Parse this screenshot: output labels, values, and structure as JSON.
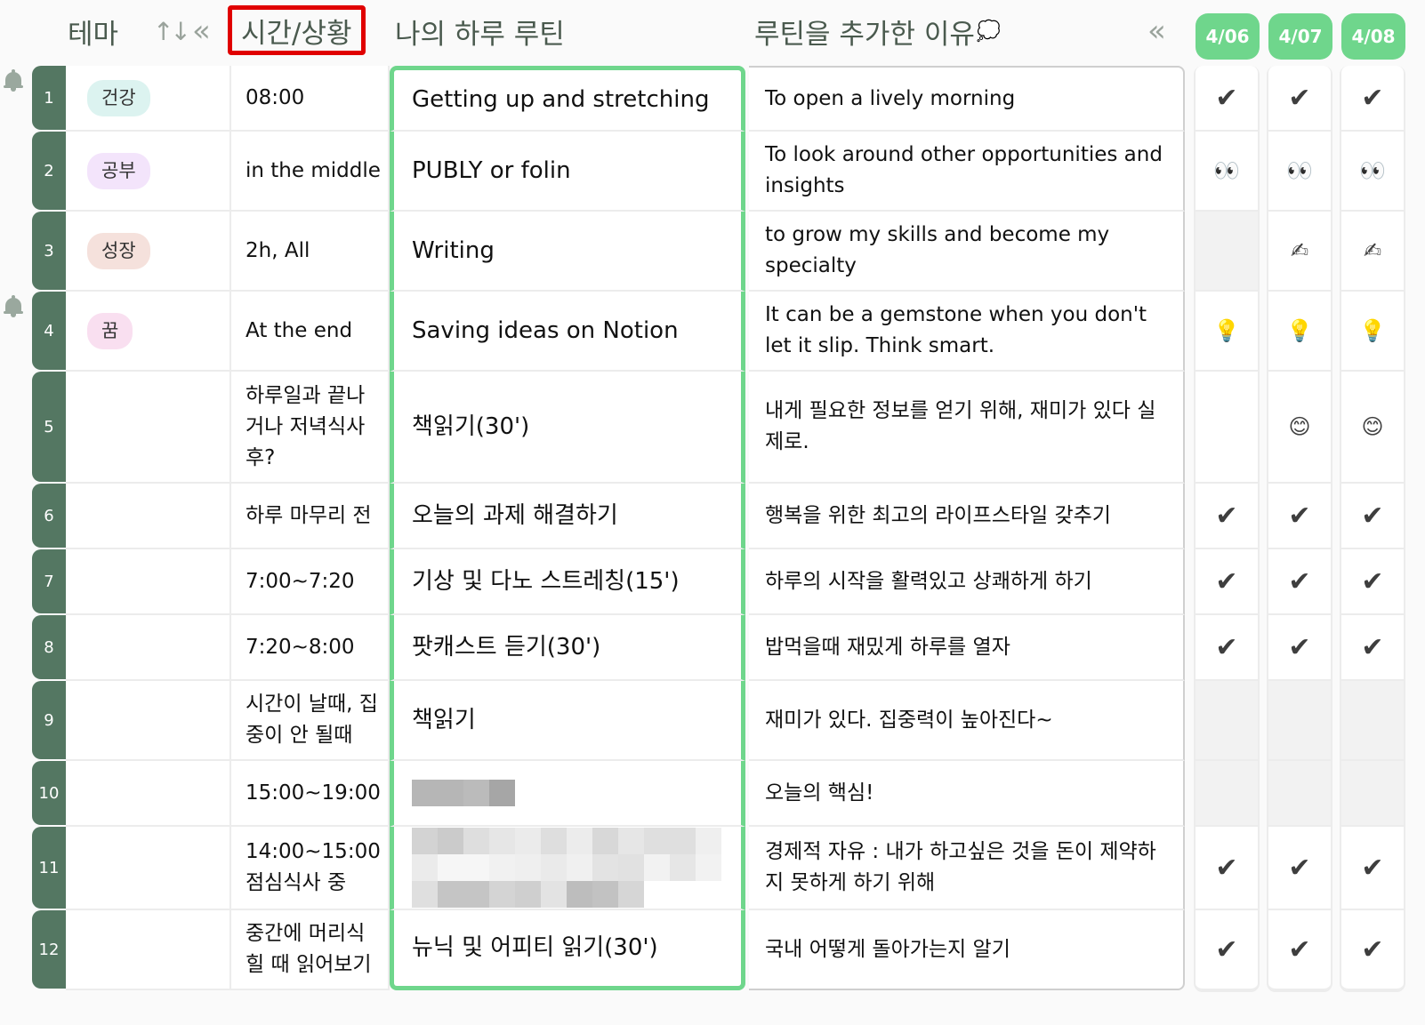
{
  "header": {
    "theme": "테마",
    "sort_icon": "↑↓",
    "collapse_icon": "«",
    "time_situation": "시간/상황",
    "my_routine": "나의 하루 루틴",
    "reason": "루틴을 추가한 이유",
    "reason_emoji": "💭",
    "collapse_dates_icon": "«",
    "dates": [
      "4/06",
      "4/07",
      "4/08"
    ]
  },
  "colors": {
    "row_number_bg": "#547762",
    "accent_green": "#6fd68c",
    "highlight_red": "#e00000"
  },
  "rows": [
    {
      "num": "1",
      "theme": "건강",
      "theme_color": "#dcf3f0",
      "time": "08:00",
      "routine": "Getting up and stretching",
      "reason": "To open a lively morning",
      "checks": [
        "✔",
        "✔",
        "✔"
      ],
      "bell": true
    },
    {
      "num": "2",
      "theme": "공부",
      "theme_color": "#f3e4fb",
      "time": "in the middle",
      "routine": "PUBLY or folin",
      "reason": "To look around other opportunities and insights",
      "checks": [
        "👀",
        "👀",
        "👀"
      ],
      "bell": false
    },
    {
      "num": "3",
      "theme": "성장",
      "theme_color": "#f5e1dc",
      "time": "2h, All",
      "routine": "Writing",
      "reason": "to grow my skills and become my specialty",
      "checks": [
        "",
        "✍",
        "✍"
      ],
      "bell": false
    },
    {
      "num": "4",
      "theme": "꿈",
      "theme_color": "#f9dff0",
      "time": "At the end",
      "routine": "Saving ideas on Notion",
      "reason": "It can be a gemstone when you don't let it slip. Think smart.",
      "checks": [
        "💡",
        "💡",
        "💡"
      ],
      "bell": true
    },
    {
      "num": "5",
      "theme": "",
      "theme_color": "",
      "time": "하루일과 끝나거나 저녁식사 후?",
      "routine": "책읽기(30')",
      "reason": "내게 필요한 정보를 얻기 위해, 재미가 있다 실제로.",
      "checks": [
        " ",
        "😊",
        "😊"
      ],
      "bell": false
    },
    {
      "num": "6",
      "theme": "",
      "theme_color": "",
      "time": "하루 마무리 전",
      "routine": "오늘의 과제 해결하기",
      "reason": "행복을 위한 최고의 라이프스타일 갖추기",
      "checks": [
        "✔",
        "✔",
        "✔"
      ],
      "bell": false
    },
    {
      "num": "7",
      "theme": "",
      "theme_color": "",
      "time": "7:00~7:20",
      "routine": "기상 및 다노 스트레칭(15')",
      "reason": "하루의 시작을 활력있고 상쾌하게 하기",
      "checks": [
        "✔",
        "✔",
        "✔"
      ],
      "bell": false
    },
    {
      "num": "8",
      "theme": "",
      "theme_color": "",
      "time": "7:20~8:00",
      "routine": "팟캐스트 듣기(30')",
      "reason": "밥먹을때 재밌게 하루를 열자",
      "checks": [
        "✔",
        "✔",
        "✔"
      ],
      "bell": false
    },
    {
      "num": "9",
      "theme": "",
      "theme_color": "",
      "time": "시간이 날때, 집중이 안 될때",
      "routine": "책읽기",
      "reason": "재미가 있다. 집중력이 높아진다~",
      "checks": [
        "",
        "",
        ""
      ],
      "bell": false
    },
    {
      "num": "10",
      "theme": "",
      "theme_color": "",
      "time": "15:00~19:00",
      "routine": "[blurred]",
      "reason": "오늘의 핵심!",
      "checks": [
        "",
        "",
        ""
      ],
      "bell": false
    },
    {
      "num": "11",
      "theme": "",
      "theme_color": "",
      "time": "14:00~15:00 점심식사 중",
      "routine": "[blurred]",
      "reason": "경제적 자유 : 내가 하고싶은 것을 돈이 제약하지 못하게 하기 위해",
      "checks": [
        "✔",
        "✔",
        "✔"
      ],
      "bell": false
    },
    {
      "num": "12",
      "theme": "",
      "theme_color": "",
      "time": "중간에 머리식힐 때 읽어보기",
      "routine": "뉴닉 및 어피티 읽기(30')",
      "reason": "국내 어떻게 돌아가는지 알기",
      "checks": [
        "✔",
        "✔",
        "✔"
      ],
      "bell": false
    }
  ]
}
